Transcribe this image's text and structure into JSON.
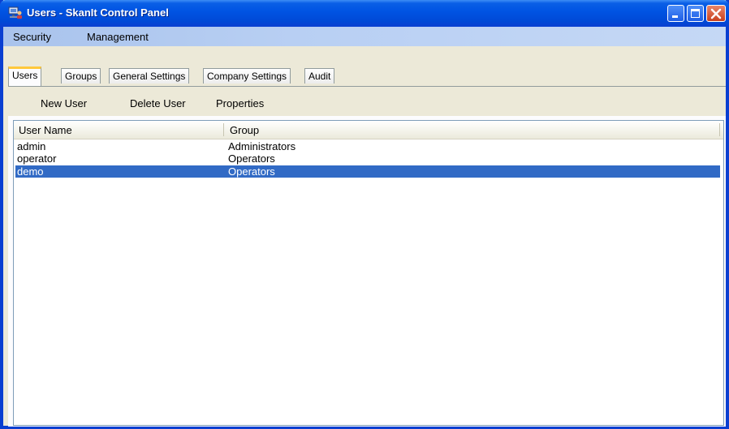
{
  "window": {
    "title": "Users - SkanIt Control Panel",
    "icon": "computer-users-icon"
  },
  "menu": {
    "items": [
      {
        "label": "Security"
      },
      {
        "label": "Management"
      }
    ]
  },
  "tabs": [
    {
      "label": "Users",
      "active": true
    },
    {
      "label": "Groups",
      "active": false
    },
    {
      "label": "General Settings",
      "active": false
    },
    {
      "label": "Company Settings",
      "active": false
    },
    {
      "label": "Audit",
      "active": false
    }
  ],
  "toolbar": {
    "new_user": "New User",
    "delete_user": "Delete User",
    "properties": "Properties"
  },
  "table": {
    "columns": [
      "User Name",
      "Group"
    ],
    "rows": [
      {
        "name": "admin",
        "group": "Administrators",
        "selected": false
      },
      {
        "name": "operator",
        "group": "Operators",
        "selected": false
      },
      {
        "name": "demo",
        "group": "Operators",
        "selected": true
      }
    ]
  },
  "colors": {
    "titlebar": "#0054e3",
    "selection": "#316ac5",
    "tab_accent": "#ffc83c"
  }
}
